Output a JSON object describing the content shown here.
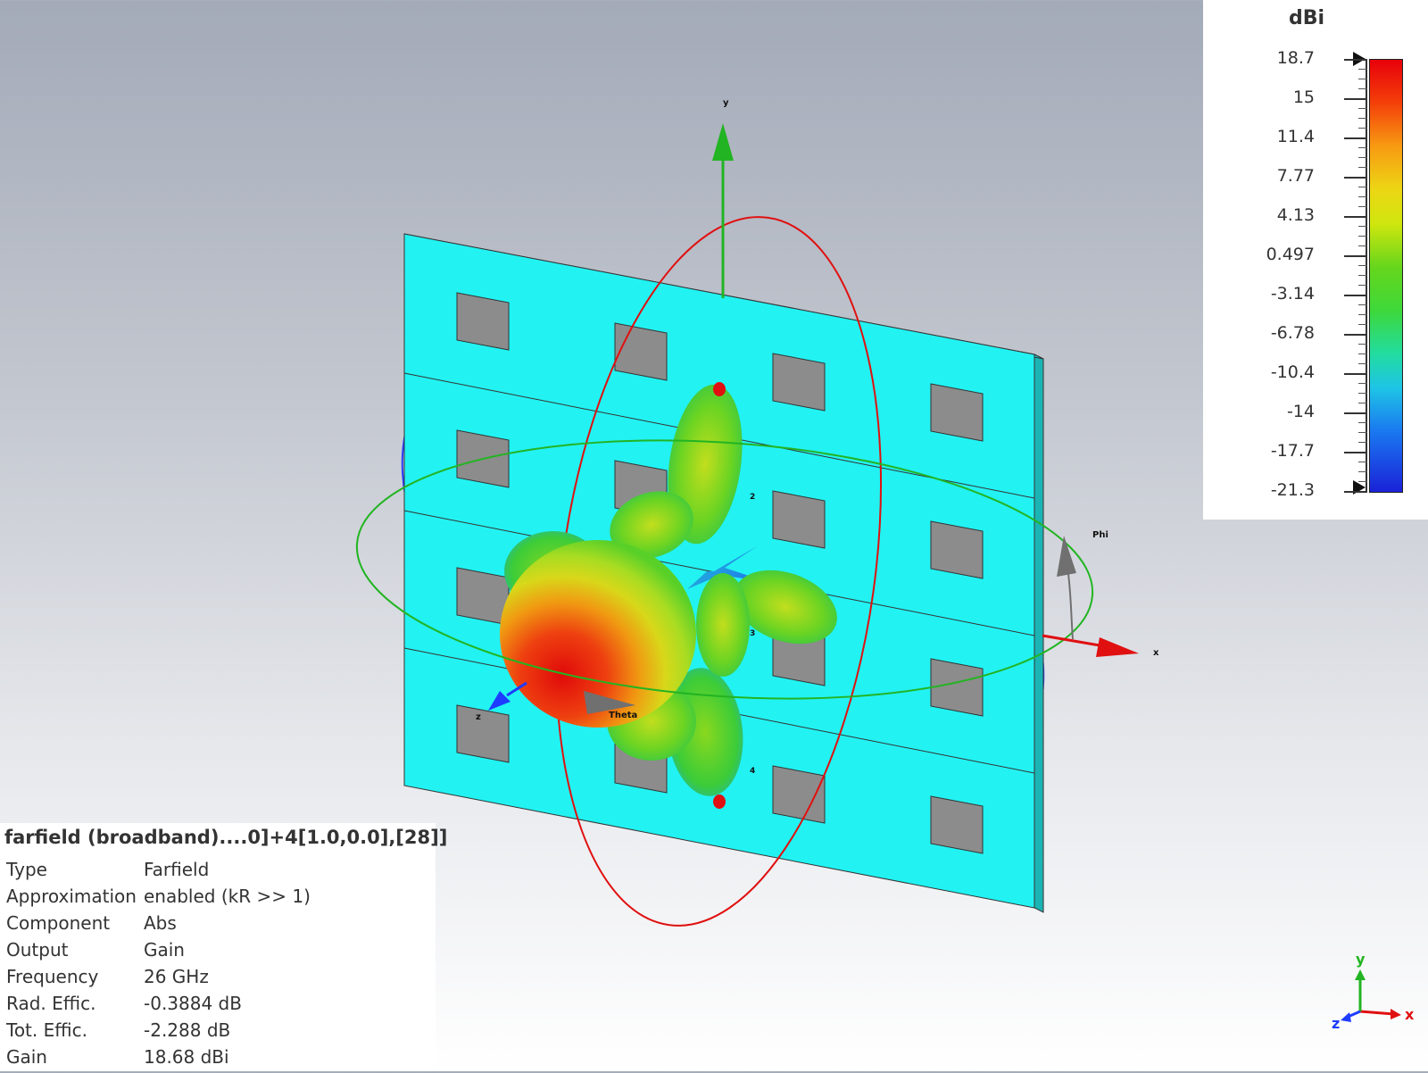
{
  "viewport": {
    "axes": {
      "x": "x",
      "y": "y",
      "z": "z"
    },
    "angle_labels": {
      "theta": "Theta",
      "phi": "Phi"
    },
    "port_labels": [
      "2",
      "3",
      "4"
    ],
    "colors": {
      "substrate": "#22f2f2",
      "patch": "#8c8c8c",
      "x_axis": "#e01010",
      "y_axis": "#22b422",
      "z_axis": "#1e3cff"
    }
  },
  "legend": {
    "unit": "dBi",
    "ticks": [
      "18.7",
      "15",
      "11.4",
      "7.77",
      "4.13",
      "0.497",
      "-3.14",
      "-6.78",
      "-10.4",
      "-14",
      "-17.7",
      "-21.3"
    ]
  },
  "info": {
    "title": "farfield (broadband)....0]+4[1.0,0.0],[28]]",
    "rows": [
      {
        "key": "Type",
        "value": "Farfield"
      },
      {
        "key": "Approximation",
        "value": "enabled (kR >> 1)"
      },
      {
        "key": "Component",
        "value": "Abs"
      },
      {
        "key": "Output",
        "value": "Gain"
      },
      {
        "key": "Frequency",
        "value": "26 GHz"
      },
      {
        "key": "Rad. Effic.",
        "value": "-0.3884 dB"
      },
      {
        "key": "Tot. Effic.",
        "value": "-2.288 dB"
      },
      {
        "key": "Gain",
        "value": "18.68 dBi"
      }
    ]
  },
  "triad": {
    "x": "x",
    "y": "y",
    "z": "z"
  }
}
